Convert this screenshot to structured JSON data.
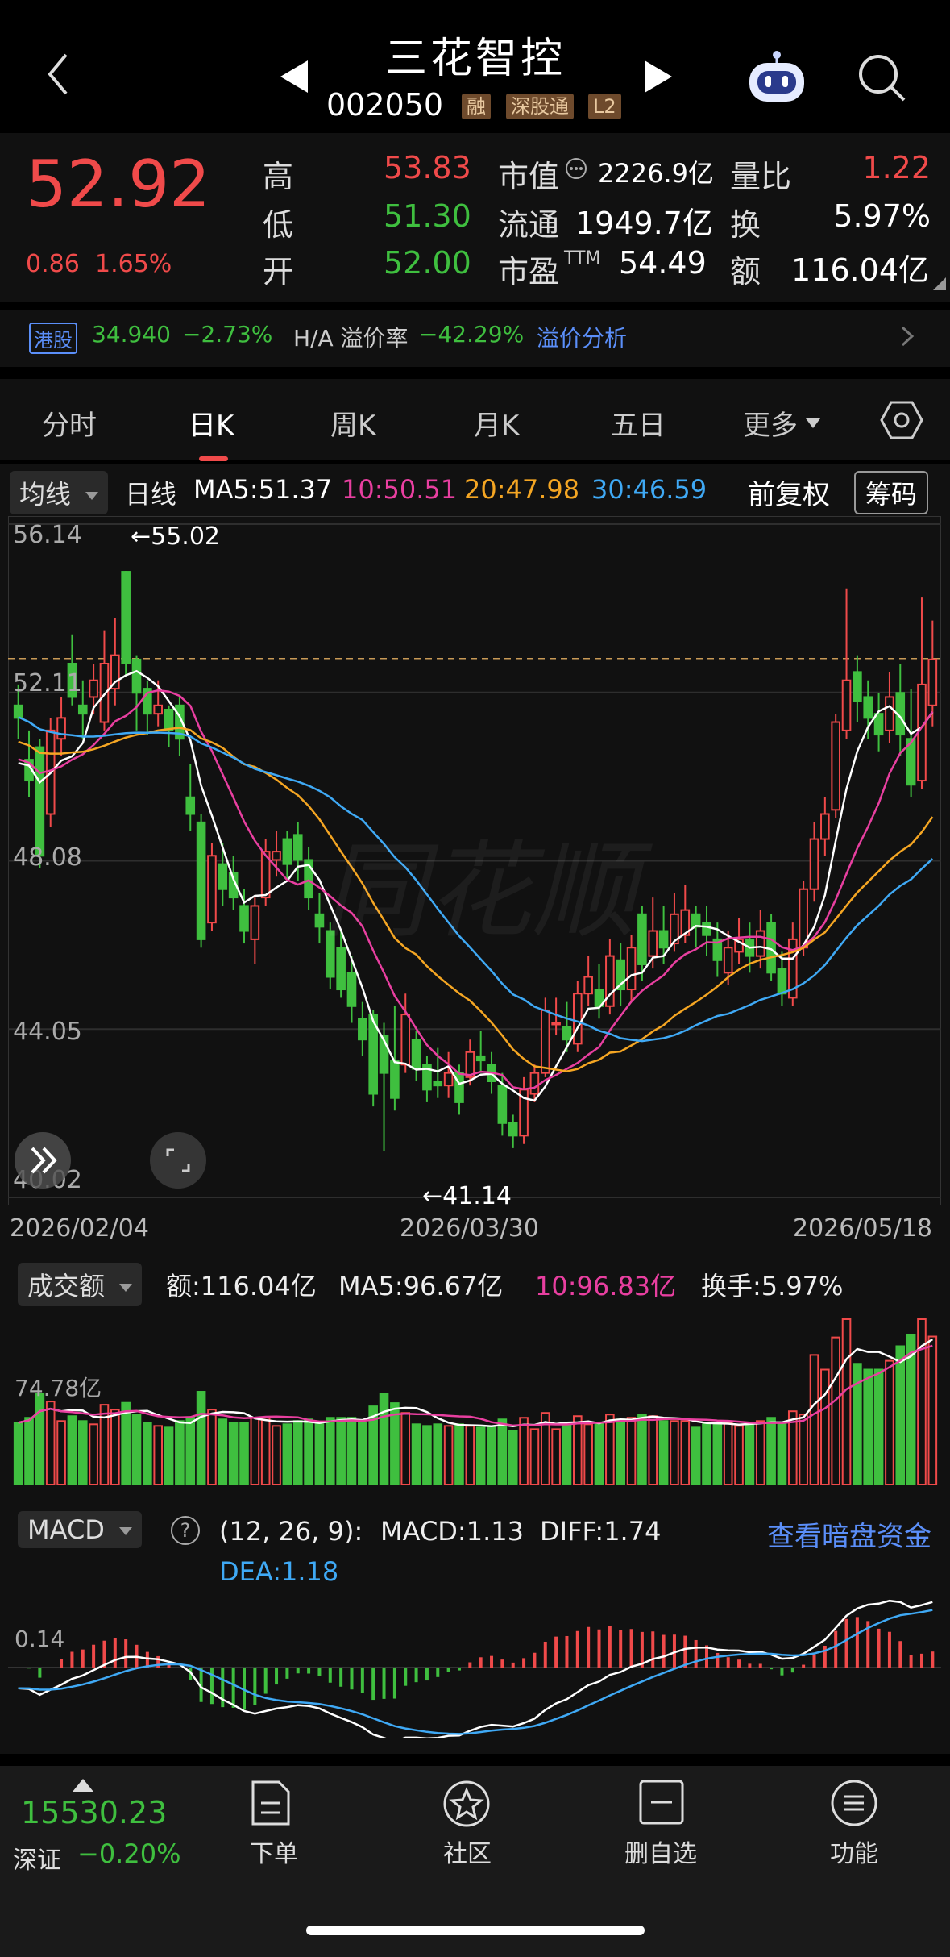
{
  "header": {
    "stock_name": "三花智控",
    "stock_code": "002050",
    "tags": [
      "融",
      "深股通",
      "L2"
    ]
  },
  "quote": {
    "price": "52.92",
    "change": "0.86",
    "change_pct": "1.65%",
    "high_label": "高",
    "high": "53.83",
    "low_label": "低",
    "low": "51.30",
    "open_label": "开",
    "open": "52.00",
    "mktcap_label": "市值",
    "mktcap": "2226.9亿",
    "float_label": "流通",
    "float": "1949.7亿",
    "pe_label": "市盈",
    "pe_suffix": "TTM",
    "pe": "54.49",
    "vol_ratio_label": "量比",
    "vol_ratio": "1.22",
    "turnover_label": "换",
    "turnover": "5.97%",
    "amount_label": "额",
    "amount": "116.04亿"
  },
  "hk": {
    "tag": "港股",
    "price": "34.940",
    "change_pct": "−2.73%",
    "premium_label": "H/A 溢价率",
    "premium": "−42.29%",
    "analysis_link": "溢价分析"
  },
  "tabs": [
    "分时",
    "日K",
    "周K",
    "月K",
    "五日",
    "更多"
  ],
  "ma_bar": {
    "selector": "均线",
    "kind": "日线",
    "ma5": "MA5:51.37",
    "ma10": "10:50.51",
    "ma20": "20:47.98",
    "ma30": "30:46.59",
    "adjust": "前复权",
    "chips": "筹码"
  },
  "kchart": {
    "y_labels": [
      "56.14",
      "52.11",
      "48.08",
      "44.05",
      "40.02"
    ],
    "high_mark": "←55.02",
    "low_mark": "←41.14",
    "dates": [
      "2026/02/04",
      "2026/03/30",
      "2026/05/18"
    ]
  },
  "volume": {
    "selector": "成交额",
    "amount": "额:116.04亿",
    "ma5": "MA5:96.67亿",
    "ma10": "10:96.83亿",
    "turnover": "换手:5.97%",
    "level": "74.78亿"
  },
  "macd": {
    "selector": "MACD",
    "help": "?",
    "params": "(12, 26, 9):",
    "macd": "MACD:1.13",
    "diff": "DIFF:1.74",
    "dea": "DEA:1.18",
    "link": "查看暗盘资金",
    "level": "0.14"
  },
  "bottom": {
    "index_value": "15530.23",
    "index_name": "深证",
    "index_change": "−0.20%",
    "nav": [
      "下单",
      "社区",
      "删自选",
      "功能"
    ]
  },
  "colors": {
    "up": "#f04a4a",
    "down": "#3fbf3f",
    "ma5": "#ffffff",
    "ma10": "#e83fa0",
    "ma20": "#f5a623",
    "ma30": "#3fa9f5",
    "link": "#5b8ff9"
  },
  "chart_data": {
    "type": "candlestick",
    "title": "三花智控 日K",
    "ylim": [
      40.02,
      56.14
    ],
    "x_labels": [
      "2026/02/04",
      "2026/03/30",
      "2026/05/18"
    ],
    "series": [
      {
        "name": "MA5",
        "value": 51.37
      },
      {
        "name": "MA10",
        "value": 50.51
      },
      {
        "name": "MA20",
        "value": 47.98
      },
      {
        "name": "MA30",
        "value": 46.59
      }
    ],
    "annotations": {
      "high": 55.02,
      "low": 41.14,
      "last": 52.92
    },
    "candles": [
      [
        51.8,
        51.5,
        52.3,
        51.0
      ],
      [
        50.5,
        50.0,
        51.2,
        49.6
      ],
      [
        50.8,
        48.2,
        51.0,
        47.9
      ],
      [
        49.2,
        51.2,
        51.5,
        48.9
      ],
      [
        51.0,
        51.5,
        52.0,
        50.6
      ],
      [
        52.8,
        52.0,
        53.5,
        51.8
      ],
      [
        51.8,
        51.6,
        52.4,
        51.0
      ],
      [
        52.0,
        52.4,
        52.8,
        51.6
      ],
      [
        51.4,
        52.8,
        53.6,
        51.2
      ],
      [
        52.2,
        53.0,
        53.9,
        51.8
      ],
      [
        55.0,
        52.8,
        55.02,
        52.5
      ],
      [
        52.9,
        52.1,
        53.0,
        51.2
      ],
      [
        52.2,
        51.6,
        52.4,
        51.1
      ],
      [
        51.6,
        51.8,
        52.4,
        51.3
      ],
      [
        51.7,
        51.2,
        51.8,
        50.8
      ],
      [
        51.8,
        51.0,
        52.0,
        50.6
      ],
      [
        49.6,
        49.2,
        50.4,
        48.8
      ],
      [
        49.0,
        46.2,
        49.2,
        46.0
      ],
      [
        46.6,
        48.2,
        48.5,
        46.4
      ],
      [
        48.0,
        47.4,
        48.5,
        47.0
      ],
      [
        47.8,
        47.2,
        48.2,
        46.9
      ],
      [
        47.0,
        46.4,
        47.4,
        46.1
      ],
      [
        46.2,
        47.0,
        47.2,
        45.6
      ],
      [
        47.2,
        48.3,
        48.6,
        47.0
      ],
      [
        48.1,
        48.3,
        48.8,
        47.7
      ],
      [
        48.6,
        48.0,
        48.8,
        47.6
      ],
      [
        48.7,
        48.1,
        49.0,
        47.6
      ],
      [
        48.1,
        47.2,
        48.4,
        46.9
      ],
      [
        46.8,
        46.5,
        47.3,
        46.1
      ],
      [
        46.4,
        45.3,
        46.6,
        45.0
      ],
      [
        46.0,
        45.0,
        46.4,
        44.8
      ],
      [
        45.4,
        44.6,
        45.8,
        44.2
      ],
      [
        44.3,
        43.8,
        44.7,
        43.4
      ],
      [
        44.4,
        42.5,
        44.5,
        42.2
      ],
      [
        43.9,
        43.0,
        44.2,
        41.14
      ],
      [
        43.3,
        42.4,
        44.6,
        42.1
      ],
      [
        43.2,
        44.4,
        44.9,
        43.0
      ],
      [
        43.8,
        43.1,
        44.0,
        42.8
      ],
      [
        43.2,
        42.6,
        43.4,
        42.3
      ],
      [
        42.8,
        42.7,
        43.6,
        42.4
      ],
      [
        42.7,
        43.0,
        43.5,
        42.4
      ],
      [
        43.0,
        42.3,
        43.2,
        42.0
      ],
      [
        42.9,
        43.5,
        43.8,
        42.7
      ],
      [
        43.4,
        43.3,
        44.0,
        43.0
      ],
      [
        43.2,
        42.8,
        43.5,
        42.5
      ],
      [
        42.7,
        41.8,
        43.0,
        41.5
      ],
      [
        41.8,
        41.5,
        42.0,
        41.2
      ],
      [
        41.5,
        42.6,
        42.9,
        41.3
      ],
      [
        42.5,
        43.0,
        43.2,
        42.3
      ],
      [
        43.0,
        44.5,
        44.8,
        42.9
      ],
      [
        44.2,
        44.2,
        44.8,
        43.9
      ],
      [
        44.1,
        43.8,
        44.7,
        43.5
      ],
      [
        43.7,
        44.9,
        45.2,
        43.5
      ],
      [
        44.9,
        45.3,
        45.8,
        44.6
      ],
      [
        45.0,
        44.6,
        45.6,
        44.3
      ],
      [
        44.6,
        45.8,
        46.2,
        44.4
      ],
      [
        45.7,
        45.0,
        46.1,
        44.6
      ],
      [
        45.0,
        46.0,
        46.3,
        44.7
      ],
      [
        46.8,
        45.6,
        47.0,
        45.2
      ],
      [
        45.8,
        46.4,
        47.2,
        45.5
      ],
      [
        46.4,
        46.0,
        47.0,
        45.6
      ],
      [
        46.1,
        46.8,
        47.3,
        45.9
      ],
      [
        46.3,
        46.9,
        47.5,
        46.1
      ],
      [
        46.8,
        46.5,
        47.0,
        46.0
      ],
      [
        46.6,
        46.3,
        47.0,
        45.8
      ],
      [
        46.2,
        45.7,
        46.6,
        45.3
      ],
      [
        45.4,
        46.0,
        46.4,
        45.1
      ],
      [
        45.9,
        46.2,
        46.7,
        45.6
      ],
      [
        46.2,
        45.8,
        46.6,
        45.4
      ],
      [
        45.8,
        46.4,
        46.9,
        45.5
      ],
      [
        46.6,
        45.4,
        46.8,
        45.2
      ],
      [
        45.5,
        44.9,
        45.9,
        44.6
      ],
      [
        44.8,
        46.2,
        46.6,
        44.6
      ],
      [
        46.0,
        47.4,
        47.6,
        45.8
      ],
      [
        47.4,
        48.6,
        49.0,
        47.1
      ],
      [
        48.6,
        49.2,
        49.6,
        48.2
      ],
      [
        49.3,
        51.4,
        51.6,
        49.1
      ],
      [
        51.2,
        52.4,
        54.6,
        51.0
      ],
      [
        52.6,
        51.9,
        53.0,
        51.4
      ],
      [
        52.0,
        51.5,
        52.4,
        51.0
      ],
      [
        51.6,
        51.1,
        52.1,
        50.7
      ],
      [
        51.2,
        52.0,
        52.6,
        50.9
      ],
      [
        52.1,
        51.1,
        52.8,
        50.6
      ],
      [
        51.0,
        49.9,
        52.2,
        49.6
      ],
      [
        50.0,
        52.3,
        54.4,
        49.8
      ],
      [
        51.8,
        52.9,
        53.83,
        51.3
      ]
    ]
  }
}
